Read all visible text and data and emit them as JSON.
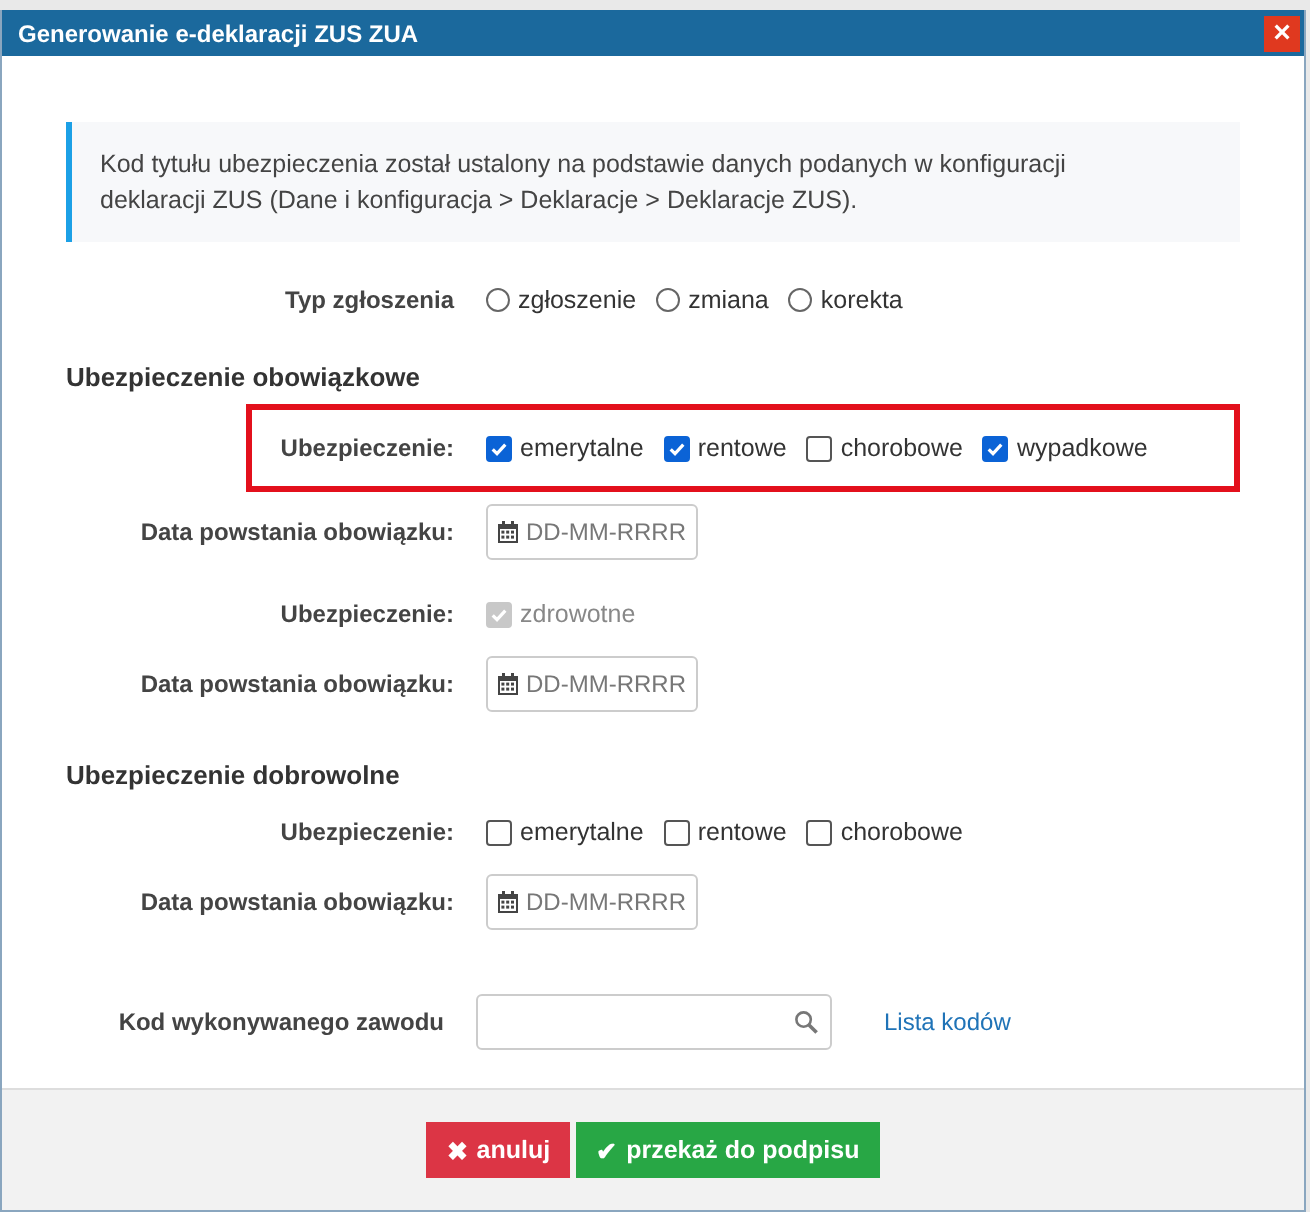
{
  "dialog": {
    "title": "Generowanie e-deklaracji ZUS ZUA",
    "close": "×"
  },
  "info": "Kod tytułu ubezpieczenia został ustalony na podstawie danych podanych w konfiguracji deklaracji ZUS (Dane i konfiguracja > Deklaracje > Deklaracje ZUS).",
  "sections": [
    {
      "rows": [
        {
          "kind": "radio",
          "label": "Typ zgłoszenia",
          "highlighted": false,
          "options": [
            {
              "label": "zgłoszenie",
              "selected": false
            },
            {
              "label": "zmiana",
              "selected": false
            },
            {
              "label": "korekta",
              "selected": false
            }
          ]
        }
      ]
    },
    {
      "heading": "Ubezpieczenie obowiązkowe",
      "rows": [
        {
          "kind": "checkboxes",
          "label": "Ubezpieczenie:",
          "highlighted": true,
          "options": [
            {
              "label": "emerytalne",
              "checked": true,
              "disabled": false
            },
            {
              "label": "rentowe",
              "checked": true,
              "disabled": false
            },
            {
              "label": "chorobowe",
              "checked": false,
              "disabled": false
            },
            {
              "label": "wypadkowe",
              "checked": true,
              "disabled": false
            }
          ]
        },
        {
          "kind": "date",
          "label": "Data powstania obowiązku:",
          "highlighted": false,
          "placeholder": "DD-MM-RRRR"
        },
        {
          "kind": "checkboxes",
          "label": "Ubezpieczenie:",
          "highlighted": false,
          "options": [
            {
              "label": "zdrowotne",
              "checked": true,
              "disabled": true
            }
          ]
        },
        {
          "kind": "date",
          "label": "Data powstania obowiązku:",
          "highlighted": false,
          "placeholder": "DD-MM-RRRR"
        }
      ]
    },
    {
      "heading": "Ubezpieczenie dobrowolne",
      "rows": [
        {
          "kind": "checkboxes",
          "label": "Ubezpieczenie:",
          "highlighted": false,
          "options": [
            {
              "label": "emerytalne",
              "checked": false,
              "disabled": false
            },
            {
              "label": "rentowe",
              "checked": false,
              "disabled": false
            },
            {
              "label": "chorobowe",
              "checked": false,
              "disabled": false
            }
          ]
        },
        {
          "kind": "date",
          "label": "Data powstania obowiązku:",
          "highlighted": false,
          "placeholder": "DD-MM-RRRR"
        }
      ]
    }
  ],
  "occupation": {
    "label": "Kod wykonywanego zawodu",
    "link": "Lista kodów"
  },
  "buttons": [
    {
      "kind": "cancel",
      "icon": "✖",
      "label": "anuluj"
    },
    {
      "kind": "confirm",
      "icon": "✔",
      "label": "przekaż do podpisu"
    }
  ]
}
